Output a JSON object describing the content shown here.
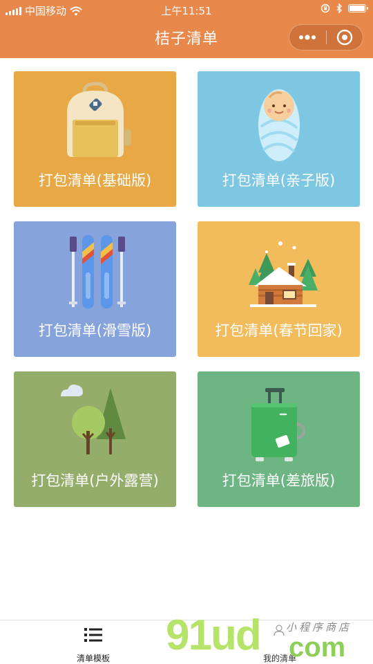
{
  "status_bar": {
    "carrier": "中国移动",
    "time": "上午11:51"
  },
  "nav": {
    "title": "桔子清单",
    "menu_icon": "more-dots-icon",
    "close_icon": "target-circle-icon"
  },
  "cards": [
    {
      "label": "打包清单(基础版)",
      "icon": "backpack-icon",
      "bg": "#e8a845"
    },
    {
      "label": "打包清单(亲子版)",
      "icon": "swaddled-baby-icon",
      "bg": "#7ec7e2"
    },
    {
      "label": "打包清单(滑雪版)",
      "icon": "skis-and-poles-icon",
      "bg": "#86a3dc"
    },
    {
      "label": "打包清单(春节回家)",
      "icon": "snowy-cabin-icon",
      "bg": "#f2bc5c"
    },
    {
      "label": "打包清单(户外露营)",
      "icon": "trees-and-cloud-icon",
      "bg": "#94ad6a"
    },
    {
      "label": "打包清单(差旅版)",
      "icon": "suitcase-icon",
      "bg": "#6db583"
    }
  ],
  "tabs": [
    {
      "label": "清单模板",
      "icon": "list-icon",
      "active": true
    },
    {
      "label": "我的清单",
      "icon": "person-icon",
      "active": false
    }
  ],
  "watermark": {
    "brand": "91ud",
    "domain": "com",
    "tagline": "小程序商店"
  },
  "colors": {
    "brand": "#e8884a",
    "text_on_card": "#ffffff"
  }
}
